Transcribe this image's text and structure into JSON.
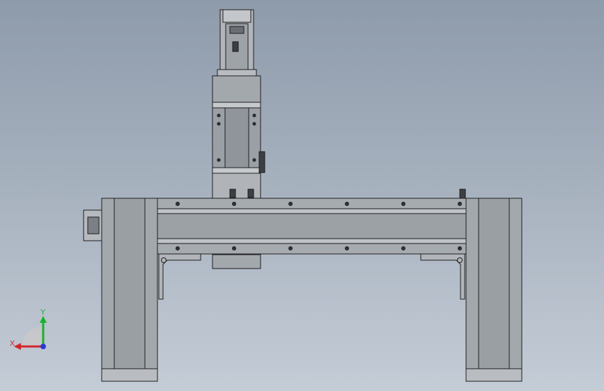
{
  "viewport": {
    "background_top": "#8e9bab",
    "background_bottom": "#c4ccd6",
    "line_color": "#1e1e1e",
    "part_fill": "#a9adb2",
    "part_fill_dark": "#8f9499"
  },
  "triad": {
    "x_label": "X",
    "y_label": "Y",
    "x_color": "#d2262a",
    "y_color": "#18b12c",
    "z_color": "#2a3ad8"
  }
}
